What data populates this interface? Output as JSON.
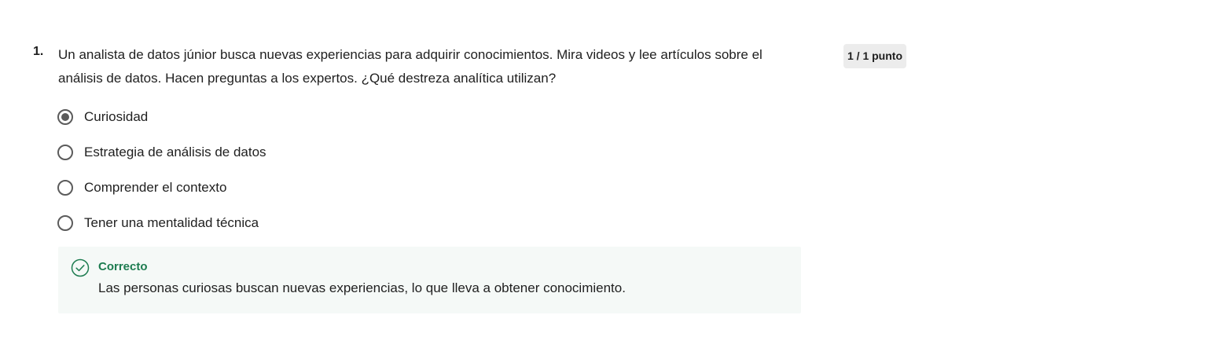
{
  "question": {
    "number": "1.",
    "text": "Un analista de datos júnior busca nuevas experiencias para adquirir conocimientos. Mira videos y lee artículos sobre el análisis de datos. Hacen preguntas a los expertos. ¿Qué destreza analítica utilizan?",
    "score": "1 / 1 punto",
    "options": [
      {
        "label": "Curiosidad",
        "selected": true
      },
      {
        "label": "Estrategia de análisis de datos",
        "selected": false
      },
      {
        "label": "Comprender el contexto",
        "selected": false
      },
      {
        "label": "Tener una mentalidad técnica",
        "selected": false
      }
    ]
  },
  "feedback": {
    "icon": "check-circle-icon",
    "title": "Correcto",
    "text": "Las personas curiosas buscan nuevas experiencias, lo que lleva a obtener conocimiento.",
    "accent_color": "#1d7c50",
    "background_color": "#f5f9f7"
  }
}
